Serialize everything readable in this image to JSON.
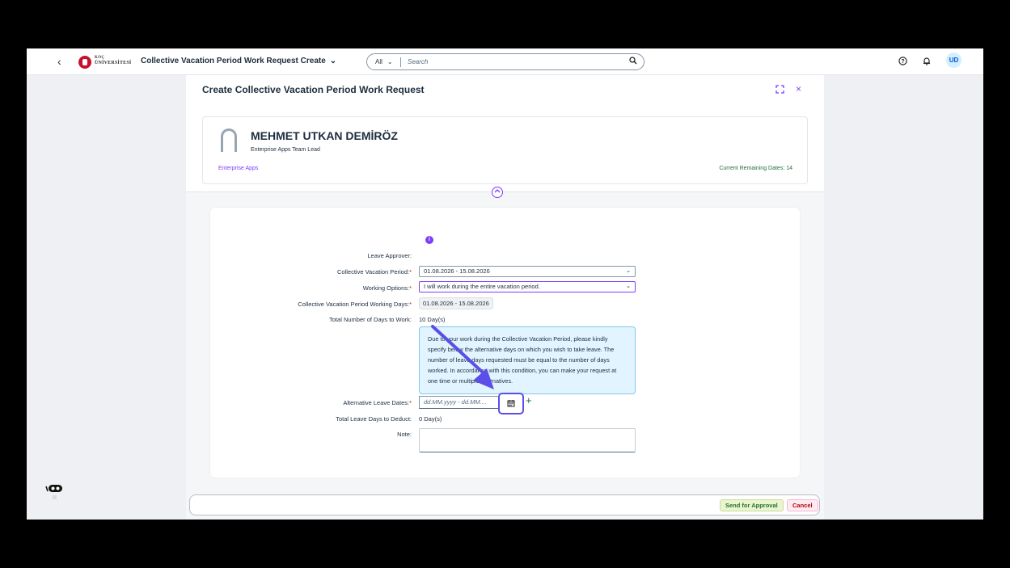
{
  "shell": {
    "back_icon": "chevron-left-icon",
    "logo_line1": "KOÇ",
    "logo_line2": "ÜNİVERSİTESİ",
    "app_title": "Collective Vacation Period Work Request Create",
    "search_scope": "All",
    "search_placeholder": "Search",
    "user_initials": "UD"
  },
  "header": {
    "title": "Create Collective Vacation Period Work Request",
    "employee_name": "MEHMET UTKAN DEMİRÖZ",
    "employee_role": "Enterprise Apps Team Lead",
    "org_unit": "Enterprise Apps",
    "remaining_dates": "Current Remaining Dates: 14"
  },
  "form": {
    "leave_approver_label": "Leave Approver:",
    "period_label": "Collective Vacation Period:",
    "period_value": "01.08.2026 - 15.08.2026",
    "working_options_label": "Working Options:",
    "working_options_value": "I will work during the entire vacation period.",
    "working_days_label": "Collective Vacation Period Working Days:",
    "working_days_value": "01.08.2026 - 15.08.2026",
    "total_days_label": "Total Number of Days to Work:",
    "total_days_value": "10 Day(s)",
    "info_message": "Due to your work during the Collective Vacation Period, please kindly specify below the alternative days on which you wish to take leave. The number of leave days requested must be equal to the number of days worked. In accordance with this condition, you can make your request at one time or multiple alternatives.",
    "alt_dates_label": "Alternative Leave Dates:",
    "alt_dates_placeholder": "dd.MM.yyyy - dd.MM....",
    "deduct_label": "Total Leave Days to Deduct:",
    "deduct_value": "0 Day(s)",
    "note_label": "Note:",
    "required_mark": "*"
  },
  "footer": {
    "send_label": "Send for Approval",
    "cancel_label": "Cancel"
  },
  "colors": {
    "accent": "#7d3cff",
    "highlight": "#5b4fe8",
    "positive": "#256f3a",
    "negative": "#aa0808"
  }
}
